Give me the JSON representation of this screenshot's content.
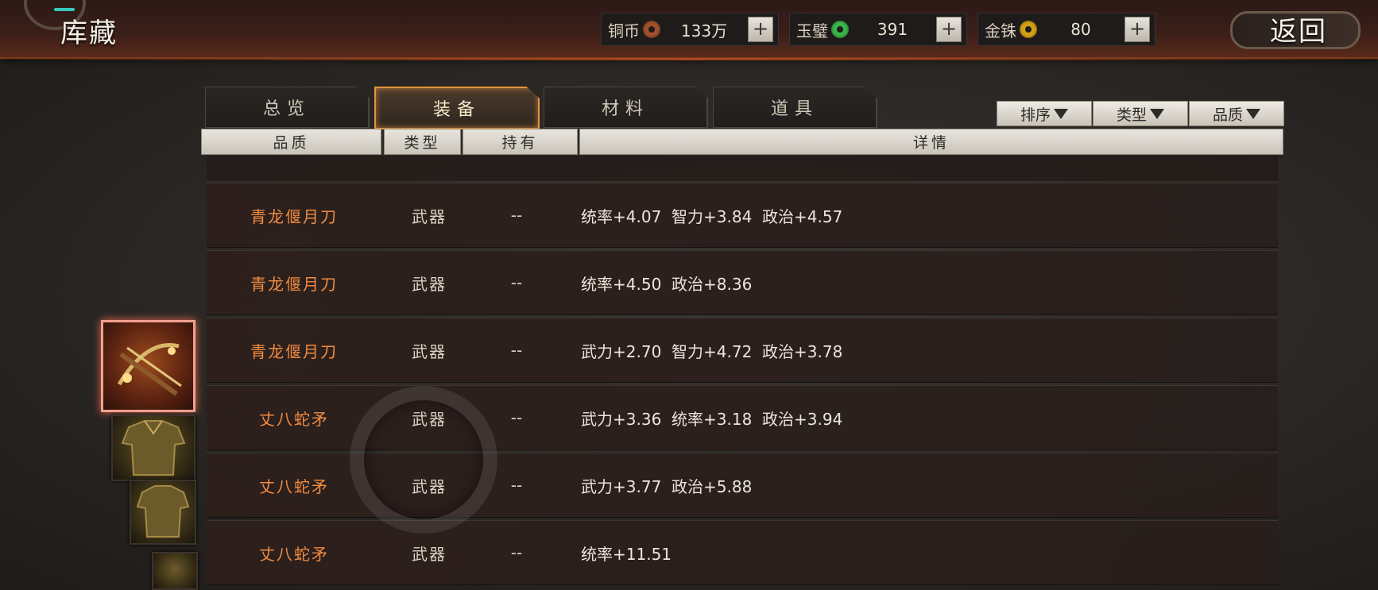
{
  "header": {
    "title": "库藏",
    "back_label": "返回",
    "currencies": [
      {
        "label": "铜币",
        "value": "133万",
        "icon": "copper-coin-icon",
        "color": "#a0522d"
      },
      {
        "label": "玉璧",
        "value": "391",
        "icon": "jade-disc-icon",
        "color": "#3bb54a"
      },
      {
        "label": "金铢",
        "value": "80",
        "icon": "gold-coin-icon",
        "color": "#d4a017"
      }
    ],
    "plus_label": "+"
  },
  "tabs": [
    {
      "label": "总览",
      "active": false
    },
    {
      "label": "装备",
      "active": true
    },
    {
      "label": "材料",
      "active": false
    },
    {
      "label": "道具",
      "active": false
    }
  ],
  "filters": [
    {
      "label": "排序"
    },
    {
      "label": "类型"
    },
    {
      "label": "品质"
    }
  ],
  "columns": {
    "quality": "品质",
    "type": "类型",
    "owned": "持有",
    "detail": "详情"
  },
  "rows": [
    {
      "name": "青龙偃月刀",
      "type": "武器",
      "owned": "--",
      "detail": "统率+4.07  智力+3.84  政治+4.57"
    },
    {
      "name": "青龙偃月刀",
      "type": "武器",
      "owned": "--",
      "detail": "统率+4.50  政治+8.36"
    },
    {
      "name": "青龙偃月刀",
      "type": "武器",
      "owned": "--",
      "detail": "武力+2.70  智力+4.72  政治+3.78"
    },
    {
      "name": "丈八蛇矛",
      "type": "武器",
      "owned": "--",
      "detail": "武力+3.36  统率+3.18  政治+3.94"
    },
    {
      "name": "丈八蛇矛",
      "type": "武器",
      "owned": "--",
      "detail": "武力+3.77  政治+5.88"
    },
    {
      "name": "丈八蛇矛",
      "type": "武器",
      "owned": "--",
      "detail": "统率+11.51"
    }
  ],
  "colors": {
    "accent_orange": "#f08c42",
    "active_tab_border": "#e0963a"
  }
}
